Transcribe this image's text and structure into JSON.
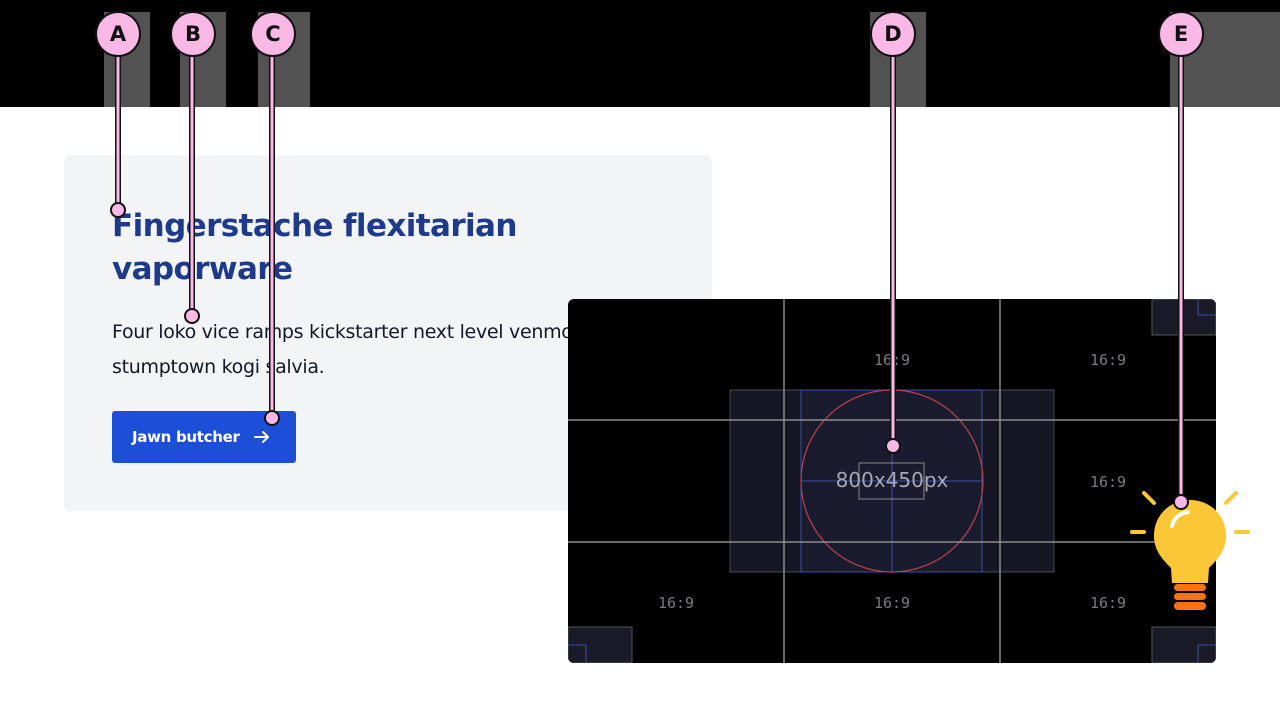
{
  "card": {
    "title": "Fingerstache flexitarian vaporware",
    "body": "Four loko vice ramps kickstarter next level venmo stumptown kogi salvia.",
    "cta_label": "Jawn butcher",
    "cta_icon": "arrow-right-icon"
  },
  "media": {
    "label": "800x450px",
    "ratio_labels": [
      "16:9",
      "16:9",
      "16:9",
      "16:9",
      "16:9",
      "16:9"
    ]
  },
  "callouts": [
    "A",
    "B",
    "C",
    "D",
    "E"
  ],
  "colors": {
    "title": "#1e3a8a",
    "button": "#1d4ed8",
    "card_bg": "#f3f4f6",
    "callout": "#f9b8e6",
    "bulb": "#fbc736",
    "bulb_base": "#f97316"
  }
}
